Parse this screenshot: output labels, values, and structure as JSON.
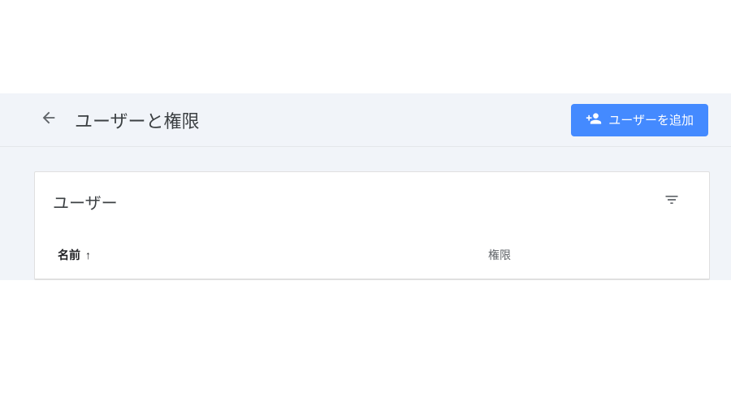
{
  "header": {
    "title": "ユーザーと権限",
    "add_button_label": "ユーザーを追加"
  },
  "card": {
    "title": "ユーザー"
  },
  "table": {
    "columns": {
      "name_label": "名前",
      "permission_label": "権限"
    },
    "sort_indicator": "↑"
  },
  "icons": {
    "back": "arrow-left-icon",
    "add_user": "person-add-icon",
    "filter": "filter-list-icon"
  },
  "colors": {
    "primary": "#448aff",
    "background": "#f1f4f9",
    "text_primary": "#3c4043",
    "text_secondary": "#5f6368"
  }
}
